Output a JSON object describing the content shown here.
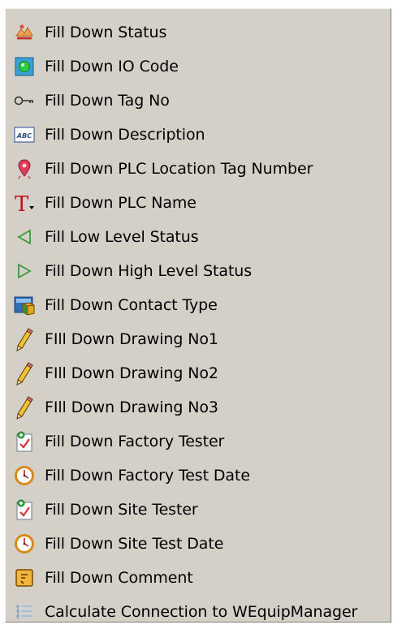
{
  "context_menu": {
    "items": [
      {
        "label": "Fill Down Status",
        "icon": "status-icon"
      },
      {
        "label": "Fill Down IO Code",
        "icon": "io-code-icon"
      },
      {
        "label": "Fill Down Tag No",
        "icon": "key-icon"
      },
      {
        "label": "Fill Down Description",
        "icon": "abc-text-icon"
      },
      {
        "label": "Fill Down PLC Location Tag Number",
        "icon": "location-pin-icon"
      },
      {
        "label": "Fill Down PLC Name",
        "icon": "text-type-icon"
      },
      {
        "label": "Fill Low Level Status",
        "icon": "triangle-left-icon"
      },
      {
        "label": "Fill Down High Level Status",
        "icon": "triangle-right-icon"
      },
      {
        "label": "Fill Down Contact Type",
        "icon": "contact-box-icon"
      },
      {
        "label": "FIll Down Drawing No1",
        "icon": "pencil-icon"
      },
      {
        "label": "FIll Down Drawing No2",
        "icon": "pencil-icon"
      },
      {
        "label": "FIll Down Drawing No3",
        "icon": "pencil-icon"
      },
      {
        "label": "Fill Down Factory Tester",
        "icon": "checklist-icon"
      },
      {
        "label": "Fill Down Factory Test Date",
        "icon": "clock-icon"
      },
      {
        "label": "Fill Down Site Tester",
        "icon": "checklist-icon"
      },
      {
        "label": "Fill Down Site Test Date",
        "icon": "clock-icon"
      },
      {
        "label": "Fill Down Comment",
        "icon": "comment-icon"
      },
      {
        "label": "Calculate Connection to WEquipManager",
        "icon": "list-icon"
      }
    ]
  }
}
